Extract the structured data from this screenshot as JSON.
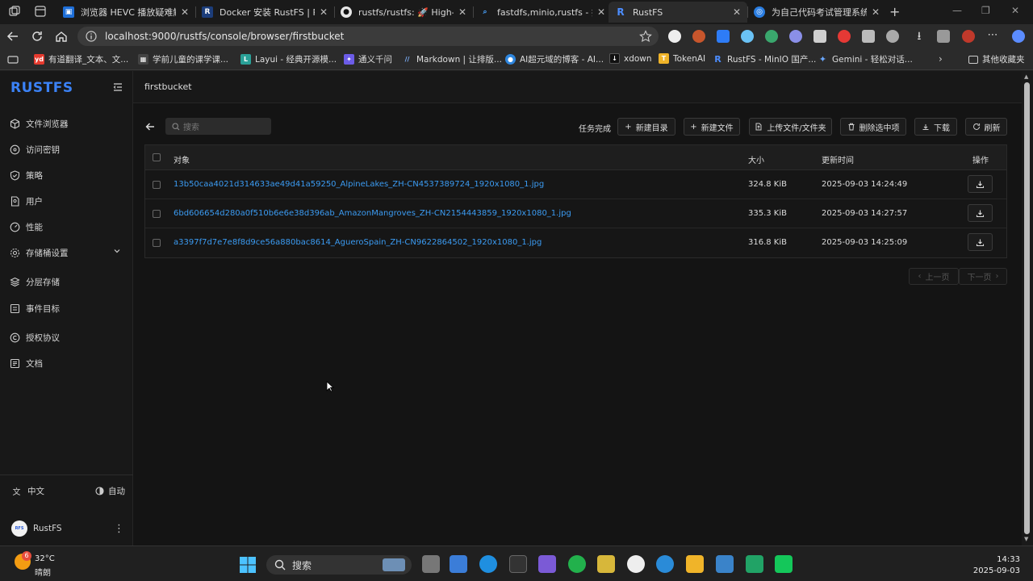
{
  "browser": {
    "tabs": [
      {
        "title": "浏览器 HEVC 播放疑难解答",
        "favicon": "doc-icon"
      },
      {
        "title": "Docker 安装 RustFS | RustF",
        "favicon": "rustfs-icon"
      },
      {
        "title": "rustfs/rustfs: 🚀 High-perf",
        "favicon": "github-icon"
      },
      {
        "title": "fastdfs,minio,rustfs - 搜索",
        "favicon": "search-icon"
      },
      {
        "title": "RustFS",
        "favicon": "rustfs-icon",
        "active": true
      },
      {
        "title": "为自己代码考试管理系统",
        "favicon": "globe-icon"
      }
    ],
    "url": "localhost:9000/rustfs/console/browser/firstbucket",
    "bookmarks": [
      {
        "label": "有道翻译_文本、文...",
        "icon": "youdao-icon"
      },
      {
        "label": "学前儿童的课学课...",
        "icon": "grid-icon"
      },
      {
        "label": "Layui - 经典开源模...",
        "icon": "layui-icon"
      },
      {
        "label": "通义千问",
        "icon": "tongyi-icon"
      },
      {
        "label": "Markdown | 让排版...",
        "icon": "markdown-icon"
      },
      {
        "label": "AI超元域的博客 - AI...",
        "icon": "blog-icon"
      },
      {
        "label": "xdown",
        "icon": "download-icon"
      },
      {
        "label": "TokenAI",
        "icon": "tokenai-icon"
      },
      {
        "label": "RustFS - MinIO 国产...",
        "icon": "rustfs-icon"
      },
      {
        "label": "Gemini - 轻松对话...",
        "icon": "gemini-icon"
      }
    ],
    "other_bookmarks": "其他收藏夹"
  },
  "app": {
    "logo": "RUSTFS",
    "breadcrumb": "firstbucket",
    "nav": [
      {
        "label": "文件浏览器",
        "icon": "cube-icon"
      },
      {
        "label": "访问密钥",
        "icon": "key-icon"
      },
      {
        "label": "策略",
        "icon": "shield-icon"
      },
      {
        "label": "用户",
        "icon": "user-icon"
      },
      {
        "label": "性能",
        "icon": "gauge-icon"
      },
      {
        "label": "存储桶设置",
        "icon": "gear-icon",
        "expandable": true
      },
      {
        "label": "分层存储",
        "icon": "layers-icon"
      },
      {
        "label": "事件目标",
        "icon": "target-icon"
      },
      {
        "label": "授权协议",
        "icon": "copyright-icon"
      },
      {
        "label": "文档",
        "icon": "doc-icon"
      }
    ],
    "language": "中文",
    "theme": "自动",
    "user": "RustFS",
    "toolbar": {
      "search_placeholder": "搜索",
      "task_status": "任务完成",
      "new_folder": "新建目录",
      "new_file": "新建文件",
      "upload": "上传文件/文件夹",
      "delete_selected": "删除选中项",
      "download": "下载",
      "refresh": "刷新"
    },
    "table": {
      "columns": [
        "对象",
        "大小",
        "更新时间",
        "操作"
      ],
      "rows": [
        {
          "name": "13b50caa4021d314633ae49d41a59250_AlpineLakes_ZH-CN4537389724_1920x1080_1.jpg",
          "size": "324.8 KiB",
          "updated": "2025-09-03 14:24:49"
        },
        {
          "name": "6bd606654d280a0f510b6e6e38d396ab_AmazonMangroves_ZH-CN2154443859_1920x1080_1.jpg",
          "size": "335.3 KiB",
          "updated": "2025-09-03 14:27:57"
        },
        {
          "name": "a3397f7d7e7e8f8d9ce56a880bac8614_AgueroSpain_ZH-CN9622864502_1920x1080_1.jpg",
          "size": "316.8 KiB",
          "updated": "2025-09-03 14:25:09"
        }
      ]
    },
    "pagination": {
      "prev": "上一页",
      "next": "下一页"
    }
  },
  "taskbar": {
    "weather_badge": "6",
    "temperature": "32°C",
    "condition": "晴朗",
    "search": "搜索",
    "time": "14:33",
    "date": "2025-09-03"
  },
  "colors": {
    "accent": "#3b82f6",
    "link": "#3b9bf2",
    "sidebar_bg": "#181818",
    "main_bg": "#141414"
  }
}
